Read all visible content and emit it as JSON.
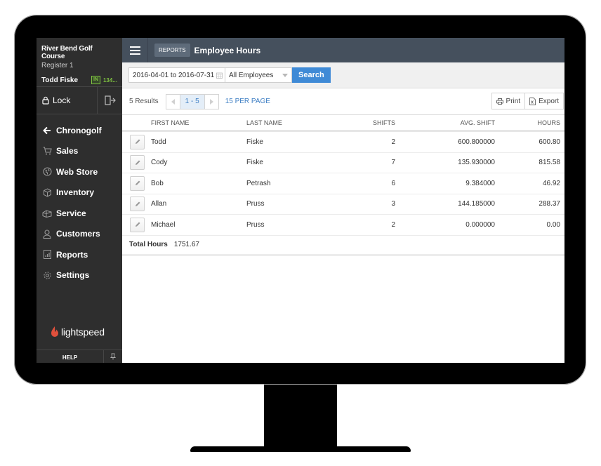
{
  "sidebar": {
    "store_name": "River Bend Golf Course",
    "register": "Register 1",
    "user_name": "Todd Fiske",
    "clock_status": "IN",
    "clock_time": "134...",
    "lock_label": "Lock",
    "nav": [
      {
        "label": "Chronogolf",
        "icon": "arrow-left-icon"
      },
      {
        "label": "Sales",
        "icon": "cart-icon"
      },
      {
        "label": "Web Store",
        "icon": "globe-icon"
      },
      {
        "label": "Inventory",
        "icon": "box-icon"
      },
      {
        "label": "Service",
        "icon": "service-icon"
      },
      {
        "label": "Customers",
        "icon": "person-icon"
      },
      {
        "label": "Reports",
        "icon": "report-icon"
      },
      {
        "label": "Settings",
        "icon": "gear-icon"
      }
    ],
    "logo_text": "lightspeed",
    "help_label": "HELP"
  },
  "header": {
    "breadcrumb": "REPORTS",
    "title": "Employee Hours"
  },
  "filters": {
    "date_range": "2016-04-01 to 2016-07-31",
    "employee_select": "All Employees",
    "search_label": "Search"
  },
  "results": {
    "count_label": "5 Results",
    "page_range": "1 - 5",
    "per_page": "15 PER PAGE",
    "print_label": "Print",
    "export_label": "Export"
  },
  "table": {
    "columns": [
      "FIRST NAME",
      "LAST NAME",
      "SHIFTS",
      "AVG. SHIFT",
      "HOURS"
    ],
    "rows": [
      {
        "first": "Todd",
        "last": "Fiske",
        "shifts": "2",
        "avg_shift": "600.800000",
        "hours": "600.80"
      },
      {
        "first": "Cody",
        "last": "Fiske",
        "shifts": "7",
        "avg_shift": "135.930000",
        "hours": "815.58"
      },
      {
        "first": "Bob",
        "last": "Petrash",
        "shifts": "6",
        "avg_shift": "9.384000",
        "hours": "46.92"
      },
      {
        "first": "Allan",
        "last": "Pruss",
        "shifts": "3",
        "avg_shift": "144.185000",
        "hours": "288.37"
      },
      {
        "first": "Michael",
        "last": "Pruss",
        "shifts": "2",
        "avg_shift": "0.000000",
        "hours": "0.00"
      }
    ],
    "total_label": "Total Hours",
    "total_value": "1751.67"
  },
  "colors": {
    "sidebar_bg": "#2e2e2e",
    "topbar_bg": "#45505d",
    "accent_blue": "#3f8ad6",
    "clock_in_green": "#7fc241",
    "logo_red": "#e0503c"
  }
}
